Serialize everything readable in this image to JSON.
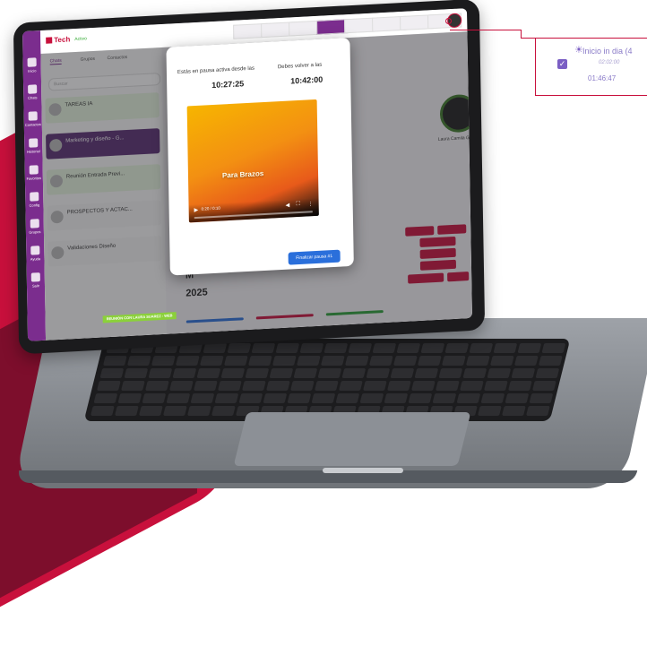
{
  "app": {
    "logo": "Tech",
    "status": "Activo"
  },
  "topbar": {
    "buttons": [
      "",
      "",
      "",
      "",
      "",
      "",
      "",
      ""
    ]
  },
  "sidebar": {
    "labels": [
      "Inicio",
      "Chats",
      "Contactos",
      "Historial",
      "Favoritos",
      "Config",
      "Grupos",
      "Ayuda",
      "Salir"
    ]
  },
  "chat_panel": {
    "tabs": [
      "Chats",
      "Grupos",
      "Contactos"
    ],
    "search_placeholder": "Buscar",
    "chats": [
      {
        "name": "TAREAS IA",
        "preview": "",
        "time": "",
        "color": "#e6f4df"
      },
      {
        "name": "Marketing y diseño - G...",
        "preview": "",
        "time": "",
        "color": "#5a2f73"
      },
      {
        "name": "Reunión Entrada Previ...",
        "preview": "",
        "time": "",
        "color": "#e6f4df"
      },
      {
        "name": "PROSPECTOS Y ACTAC...",
        "preview": "",
        "time": "",
        "color": "#f5f5f5"
      },
      {
        "name": "Validaciones Diseño",
        "preview": "",
        "time": "",
        "color": "#f5f5f5"
      }
    ]
  },
  "tags": [
    {
      "label": "",
      "color": "#2b9e38"
    },
    {
      "label": "",
      "color": "#e8b100"
    },
    {
      "label": "REUNIÓN CON LAURA SUAREZ - WEB",
      "color": "#8bd13a"
    },
    {
      "label": "",
      "color": "#7b2d8e"
    }
  ],
  "main": {
    "month_initial": "M",
    "year": "2025"
  },
  "profile": {
    "name": "Laura Camila Gomez",
    "info": [
      "",
      "",
      "",
      "",
      "",
      ""
    ],
    "buttons": [
      "",
      "",
      "",
      "",
      "",
      "",
      "",
      ""
    ]
  },
  "modal": {
    "paused_since_label": "Estás en pausa activa desde las",
    "paused_since_time": "10:27:25",
    "return_label": "Debes volver a las",
    "return_time": "10:42:00",
    "video_title_a": "",
    "video_title_b": "Para Brazos",
    "video_time": "0:20 / 0:10",
    "finish_button": "Finalizar pausa #1"
  },
  "callout": {
    "title": "Inicio in dia (4",
    "subtitle": "02:02:00",
    "time": "01:46:47",
    "checked": true
  },
  "colors": {
    "accent": "#7b2d8e",
    "brand": "#c8103c",
    "primary": "#2a6fdb"
  }
}
